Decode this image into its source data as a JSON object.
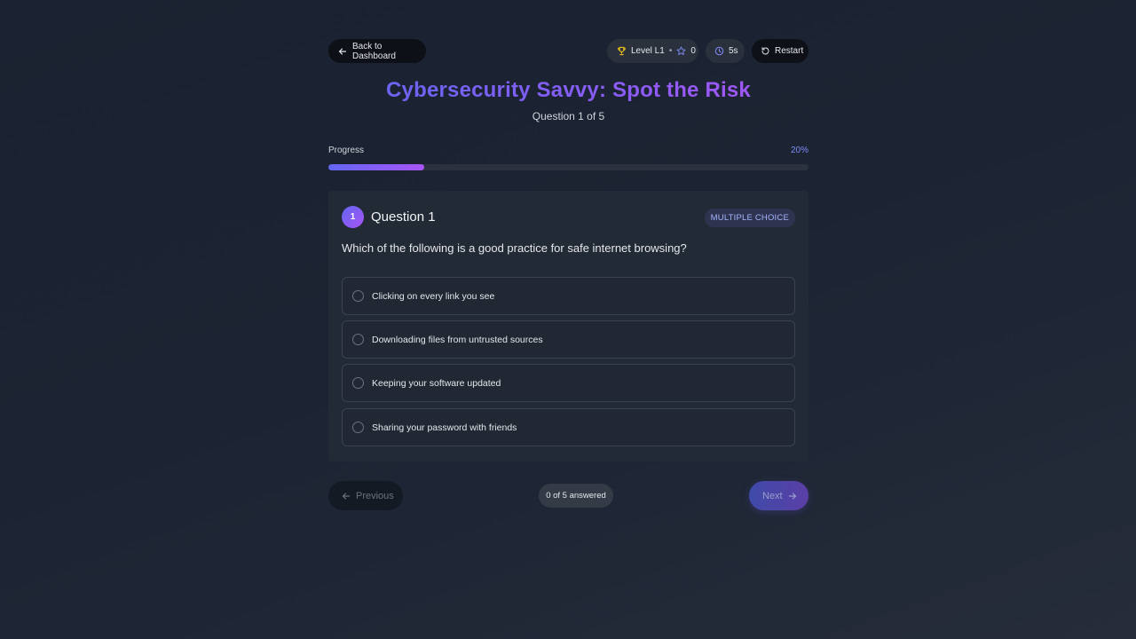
{
  "topbar": {
    "back_label": "Back to Dashboard",
    "level_label": "Level L1",
    "level_separator": "•",
    "stars": "0",
    "timer": "5s",
    "restart_label": "Restart"
  },
  "quiz": {
    "title": "Cybersecurity Savvy: Spot the Risk",
    "subtitle": "Question 1 of 5"
  },
  "progress": {
    "label": "Progress",
    "percent_text": "20%",
    "value": 0.2
  },
  "question": {
    "number": "1",
    "title": "Question 1",
    "type": "MULTIPLE CHOICE",
    "text": "Which of the following is a good practice for safe internet browsing?",
    "options": [
      "Clicking on every link you see",
      "Downloading files from untrusted sources",
      "Keeping your software updated",
      "Sharing your password with friends"
    ]
  },
  "footer": {
    "previous_label": "Previous",
    "answered_text": "0 of 5 answered",
    "next_label": "Next"
  },
  "colors": {
    "accent_start": "#6366f1",
    "accent_end": "#a855f7",
    "trophy": "#facc15",
    "star": "#818cf8",
    "clock": "#818cf8"
  },
  "icons": {
    "back": "arrow-left-icon",
    "level": "trophy-icon",
    "stars": "star-icon",
    "timer": "clock-icon",
    "restart": "rotate-ccw-icon",
    "previous": "arrow-left-icon",
    "next": "arrow-right-icon"
  }
}
